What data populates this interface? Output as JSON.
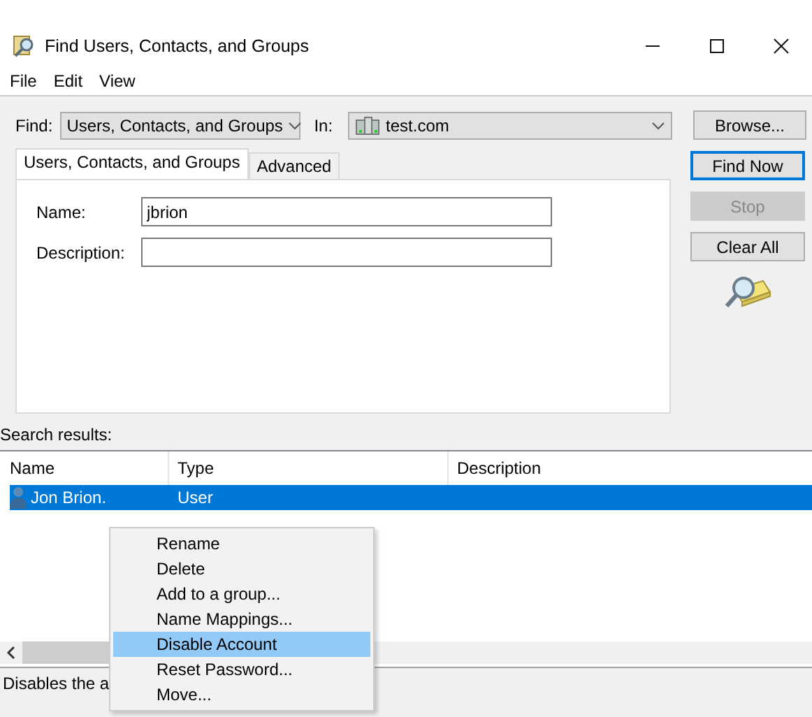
{
  "window": {
    "title": "Find Users, Contacts, and Groups"
  },
  "menu_bar": [
    "File",
    "Edit",
    "View"
  ],
  "find": {
    "label": "Find:",
    "value": "Users, Contacts, and Groups"
  },
  "in": {
    "label": "In:",
    "value": "test.com"
  },
  "browse_button": "Browse...",
  "tabs": [
    {
      "label": "Users, Contacts, and Groups",
      "selected": true
    },
    {
      "label": "Advanced",
      "selected": false
    }
  ],
  "fields": [
    {
      "label": "Name:",
      "value": "jbrion"
    },
    {
      "label": "Description:"
    }
  ],
  "buttons": [
    {
      "label": "Find Now",
      "focused": true,
      "disabled": false
    },
    {
      "label": "Stop",
      "focused": false,
      "disabled": true
    },
    {
      "label": "Clear All",
      "focused": false,
      "disabled": false
    }
  ],
  "results_label": "Search results:",
  "results": {
    "columns": [
      "Name",
      "Type",
      "Description"
    ],
    "rows": [
      {
        "name": "Jon Brion.",
        "type": "User",
        "selected": true
      }
    ]
  },
  "context_menu": [
    {
      "label": "Rename",
      "selected": false
    },
    {
      "label": "Delete",
      "selected": false
    },
    {
      "label": "Add to a group...",
      "selected": false
    },
    {
      "label": "Name Mappings...",
      "selected": false
    },
    {
      "label": "Disable Account",
      "selected": true
    },
    {
      "label": "Reset Password...",
      "selected": false
    },
    {
      "label": "Move...",
      "selected": false
    }
  ],
  "status_bar": "Disables the a"
}
